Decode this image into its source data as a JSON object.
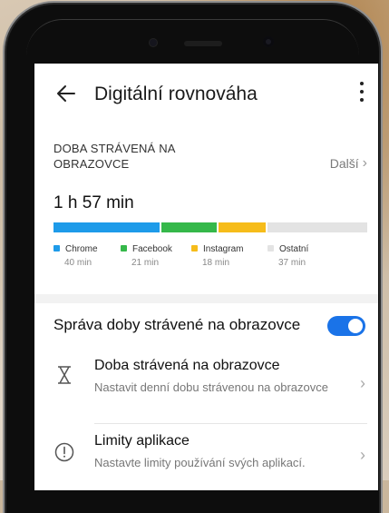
{
  "header": {
    "title": "Digitální rovnováha"
  },
  "screen_time": {
    "section_title": "DOBA STRÁVENÁ NA OBRAZOVCE",
    "more_label": "Další",
    "total": "1 h 57 min",
    "apps": [
      {
        "name": "Chrome",
        "time": "40 min",
        "minutes": 40,
        "color": "#1e9be9"
      },
      {
        "name": "Facebook",
        "time": "21 min",
        "minutes": 21,
        "color": "#35b84a"
      },
      {
        "name": "Instagram",
        "time": "18 min",
        "minutes": 18,
        "color": "#f6bc1a"
      },
      {
        "name": "Ostatní",
        "time": "37 min",
        "minutes": 37,
        "color": "#e3e3e3"
      }
    ]
  },
  "management": {
    "toggle_label": "Správa doby strávené na obrazovce",
    "toggle_on": true,
    "accent": "#1a73e8"
  },
  "items": [
    {
      "icon": "hourglass-icon",
      "title": "Doba strávená na obrazovce",
      "subtitle": "Nastavit denní dobu strávenou na obrazovce"
    },
    {
      "icon": "alert-circle-icon",
      "title": "Limity aplikace",
      "subtitle": "Nastavte limity používání svých aplikací."
    }
  ]
}
